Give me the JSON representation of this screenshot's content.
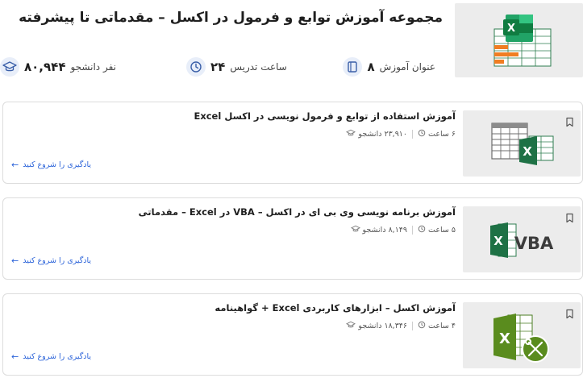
{
  "header": {
    "title": "مجموعه آموزش توابع و فرمول در اکسل – مقدماتی تا پیشرفته",
    "stats": {
      "titles_count": "۸",
      "titles_label": "عنوان آموزش",
      "hours_count": "۲۴",
      "hours_label": "ساعت تدریس",
      "students_count": "۸۰,۹۴۴",
      "students_label": "نفر دانشجو"
    }
  },
  "courses": [
    {
      "title": "آموزش استفاده از توابع و فرمول نویسی در اکسل Excel",
      "students": "۲۳,۹۱۰ دانشجو",
      "hours": "۶ ساعت",
      "cta": "یادگیری را شروع کنید"
    },
    {
      "title": "آموزش برنامه نویسی وی بی ای در اکسل – VBA در Excel – مقدماتی",
      "students": "۸,۱۴۹ دانشجو",
      "hours": "۵ ساعت",
      "cta": "یادگیری را شروع کنید",
      "thumb_text": "VBA"
    },
    {
      "title": "آموزش اکسل – ابزارهای کاربردی Excel + گواهینامه",
      "students": "۱۸,۳۴۶ دانشجو",
      "hours": "۴ ساعت",
      "cta": "یادگیری را شروع کنید"
    }
  ],
  "colors": {
    "excel_green": "#1e7145",
    "link_blue": "#2b63d9",
    "icon_bg": "#e8eef9"
  }
}
